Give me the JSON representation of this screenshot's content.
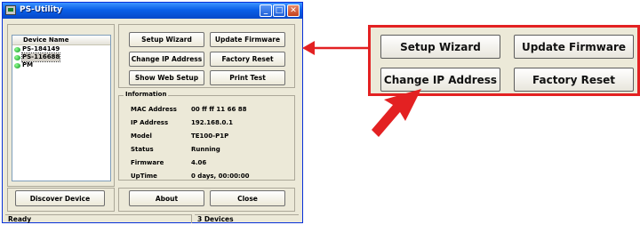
{
  "window": {
    "title": "PS-Utility",
    "controls": {
      "minimize": "_",
      "maximize": "□",
      "close": "✕"
    }
  },
  "device_list": {
    "header": "Device Name",
    "items": [
      {
        "label": "PS-184149",
        "selected": false
      },
      {
        "label": "PS-116688",
        "selected": true
      },
      {
        "label": "PM",
        "selected": false
      }
    ]
  },
  "buttons": {
    "setup_wizard": "Setup Wizard",
    "update_firmware": "Update Firmware",
    "change_ip": "Change IP Address",
    "factory_reset": "Factory Reset",
    "show_web_setup": "Show Web Setup",
    "print_test": "Print Test",
    "discover_device": "Discover Device",
    "about": "About",
    "close": "Close"
  },
  "information": {
    "title": "Information",
    "rows": [
      {
        "label": "MAC Address",
        "value": "00 ff ff 11 66 88"
      },
      {
        "label": "IP Address",
        "value": "192.168.0.1"
      },
      {
        "label": "Model",
        "value": "TE100-P1P"
      },
      {
        "label": "Status",
        "value": "Running"
      },
      {
        "label": "Firmware",
        "value": "4.06"
      },
      {
        "label": "UpTime",
        "value": "0 days, 00:00:00"
      }
    ]
  },
  "statusbar": {
    "left": "Ready",
    "right": "3 Devices"
  },
  "callout": {
    "setup_wizard": "Setup Wizard",
    "update_firmware": "Update Firmware",
    "change_ip": "Change IP Address",
    "factory_reset": "Factory Reset"
  },
  "colors": {
    "accent_red": "#e32122",
    "titlebar_blue": "#0a5fe8",
    "device_green": "#0b8f1f"
  }
}
